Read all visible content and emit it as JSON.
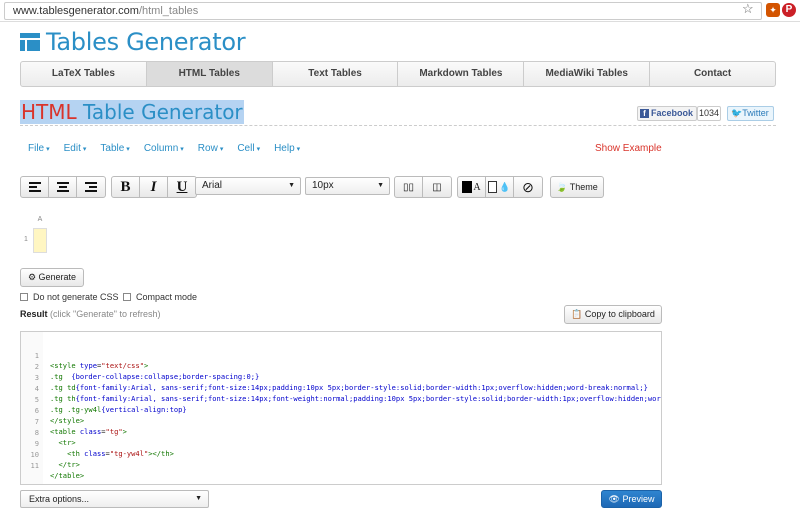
{
  "browser": {
    "url_host": "www.tablesgenerator.com",
    "url_path": "/html_tables",
    "star_icon": "star-icon",
    "ext1_icon": "extension-icon",
    "ext2_icon": "pinterest-icon",
    "ext2_glyph": "P"
  },
  "logo": {
    "text": "Tables Generator",
    "color": "#2b8fc6"
  },
  "nav": {
    "tabs": [
      {
        "label": "LaTeX Tables",
        "active": false
      },
      {
        "label": "HTML Tables",
        "active": true
      },
      {
        "label": "Text Tables",
        "active": false
      },
      {
        "label": "Markdown Tables",
        "active": false
      },
      {
        "label": "MediaWiki Tables",
        "active": false
      },
      {
        "label": "Contact",
        "active": false
      }
    ]
  },
  "heading": {
    "part1": "HTML",
    "part2": " Table Generator",
    "accent": "#d9342b"
  },
  "social": {
    "facebook": "Facebook",
    "facebook_glyph": "f",
    "count": "1034",
    "twitter": "Twitter"
  },
  "menu": {
    "items": [
      "File",
      "Edit",
      "Table",
      "Column",
      "Row",
      "Cell",
      "Help"
    ],
    "caret": "▾",
    "show_example": "Show Example"
  },
  "toolbar": {
    "bold": "B",
    "italic": "I",
    "underline": "U",
    "font": "Arial",
    "font_size": "10px",
    "theme": "Theme",
    "color_text_glyph": "A"
  },
  "grid": {
    "col_header": "A",
    "row_header": "1"
  },
  "actions": {
    "generate": "Generate",
    "no_css": "Do not generate CSS",
    "compact": "Compact mode",
    "result": "Result",
    "result_hint": "(click \"Generate\" to refresh)",
    "copy": "Copy to clipboard",
    "extra": "Extra options...",
    "preview": "Preview"
  },
  "code": {
    "line_numbers": [
      "1",
      "2",
      "3",
      "4",
      "5",
      "6",
      "7",
      "8",
      "9",
      "10",
      "11"
    ],
    "l1_tag": "<style ",
    "l1_attr": "type",
    "l1_eq": "=",
    "l1_str": "\"text/css\"",
    "l1_end": ">",
    "l2_sel": ".tg",
    "l2_rest": "  {border-collapse:collapse;border-spacing:0;}",
    "l3_sel": ".tg td",
    "l3_rest": "{font-family:Arial, sans-serif;font-size:14px;padding:10px 5px;border-style:solid;border-width:1px;overflow:hidden;word-break:normal;}",
    "l4_sel": ".tg th",
    "l4_rest": "{font-family:Arial, sans-serif;font-size:14px;font-weight:normal;padding:10px 5px;border-style:solid;border-width:1px;overflow:hidden;word-break:normal;}",
    "l5_sel": ".tg .tg-yw4l",
    "l5_rest": "{vertical-align:top}",
    "l6": "</style>",
    "l7_tag": "<table ",
    "l7_attr": "class",
    "l7_eq": "=",
    "l7_str": "\"tg\"",
    "l7_end": ">",
    "l8": "  <tr>",
    "l9_tag": "    <th ",
    "l9_attr": "class",
    "l9_eq": "=",
    "l9_str": "\"tg-yw4l\"",
    "l9_end": "></th>",
    "l10": "  </tr>",
    "l11": "</table>"
  }
}
